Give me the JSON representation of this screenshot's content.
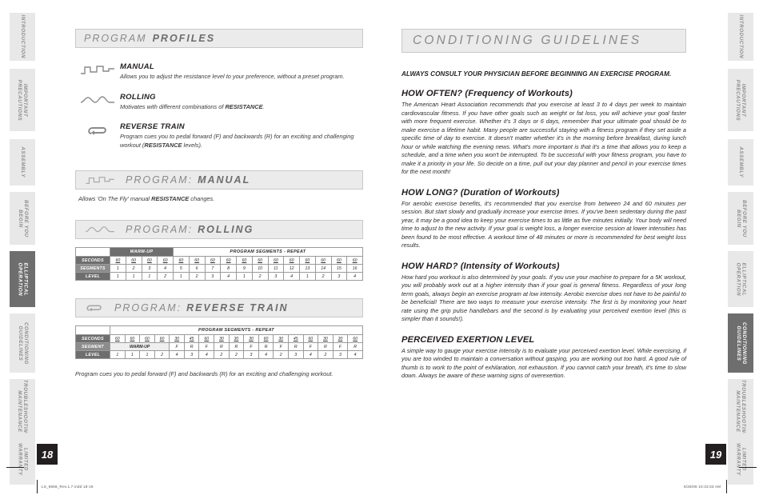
{
  "tabs_left": [
    {
      "label": "INTRODUCTION",
      "active": false
    },
    {
      "label": "IMPORTANT PRECAUTIONS",
      "active": false
    },
    {
      "label": "ASSEMBLY",
      "active": false
    },
    {
      "label": "BEFORE YOU BEGIN",
      "active": false
    },
    {
      "label": "ELLIPTICAL OPERATION",
      "active": true
    },
    {
      "label": "CONDITIONING GUIDELINES",
      "active": false
    },
    {
      "label": "TROUBLESHOOTING & MAINTENANCE",
      "active": false
    },
    {
      "label": "LIMITED WARRANTY",
      "active": false
    }
  ],
  "tabs_right": [
    {
      "label": "INTRODUCTION",
      "active": false
    },
    {
      "label": "IMPORTANT PRECAUTIONS",
      "active": false
    },
    {
      "label": "ASSEMBLY",
      "active": false
    },
    {
      "label": "BEFORE YOU BEGIN",
      "active": false
    },
    {
      "label": "ELLIPTICAL OPERATION",
      "active": false
    },
    {
      "label": "CONDITIONING GUIDELINES",
      "active": true
    },
    {
      "label": "TROUBLESHOOTING & MAINTENANCE",
      "active": false
    },
    {
      "label": "LIMITED WARRANTY",
      "active": false
    }
  ],
  "page_left": {
    "number": "18",
    "banner": {
      "word1": "PROGRAM",
      "word2": "PROFILES"
    },
    "profiles": [
      {
        "icon": "step-wave-icon",
        "title": "MANUAL",
        "desc_pre": "Allows you to adjust the resistance level to your preference, without a preset program.",
        "desc_bold": "",
        "desc_post": ""
      },
      {
        "icon": "rolling-wave-icon",
        "title": "ROLLING",
        "desc_pre": "Motivates with different combinations of ",
        "desc_bold": "RESISTANCE",
        "desc_post": "."
      },
      {
        "icon": "reverse-loop-icon",
        "title": "REVERSE TRAIN",
        "desc_pre": "Program cues you to pedal forward (F) and backwards (R) for an exciting and challenging workout (",
        "desc_bold": "RESISTANCE",
        "desc_post": " levels)."
      }
    ],
    "manual_section": {
      "banner_label": "PROGRAM:",
      "banner_name": "MANUAL",
      "note_pre": "Allows 'On The Fly' manual ",
      "note_bold": "RESISTANCE",
      "note_post": " changes."
    },
    "rolling_section": {
      "banner_label": "PROGRAM:",
      "banner_name": "ROLLING",
      "head_warmup": "WARM-UP",
      "head_segments": "PROGRAM SEGMENTS - REPEAT",
      "row_labels": [
        "SECONDS",
        "SEGMENTS",
        "LEVEL"
      ],
      "seconds": [
        "60",
        "60",
        "60",
        "60",
        "60",
        "60",
        "60",
        "60",
        "60",
        "60",
        "60",
        "60",
        "60",
        "60",
        "60",
        "60"
      ],
      "segments": [
        "1",
        "2",
        "3",
        "4",
        "5",
        "6",
        "7",
        "8",
        "9",
        "10",
        "11",
        "12",
        "13",
        "14",
        "15",
        "16"
      ],
      "level": [
        "1",
        "1",
        "1",
        "2",
        "1",
        "2",
        "3",
        "4",
        "1",
        "2",
        "3",
        "4",
        "1",
        "2",
        "3",
        "4"
      ],
      "warmup_cols": 4
    },
    "reverse_section": {
      "banner_label": "PROGRAM:",
      "banner_name": "REVERSE TRAIN",
      "head_segments": "PROGRAM SEGMENTS - REPEAT",
      "row_labels": [
        "SECONDS",
        "SEGMENT",
        "LEVEL"
      ],
      "warmup_label": "WARM-UP",
      "seconds": [
        "60",
        "60",
        "60",
        "60",
        "30",
        "45",
        "60",
        "30",
        "30",
        "30",
        "60",
        "30",
        "45",
        "60",
        "30",
        "30",
        "60"
      ],
      "segment": [
        "",
        "",
        "",
        "",
        "F",
        "R",
        "F",
        "R",
        "R",
        "F",
        "R",
        "F",
        "R",
        "F",
        "R",
        "F",
        "R"
      ],
      "level": [
        "1",
        "1",
        "1",
        "2",
        "4",
        "3",
        "4",
        "2",
        "2",
        "3",
        "4",
        "2",
        "3",
        "4",
        "2",
        "3",
        "4"
      ],
      "warmup_cols": 4,
      "footnote": "Program cues you to pedal forward (F) and backwards (R) for an exciting and challenging workout."
    }
  },
  "page_right": {
    "number": "19",
    "banner_title": "CONDITIONING GUIDELINES",
    "always_line": "ALWAYS CONSULT YOUR PHYSICIAN BEFORE BEGINNING AN EXERCISE PROGRAM.",
    "sections": [
      {
        "heading": "HOW OFTEN? (Frequency of Workouts)",
        "body": "The American Heart Association recommends that you exercise at least 3 to 4 days per week to maintain cardiovascular fitness. If you have other goals such as weight or fat loss, you will achieve your goal faster with more frequent exercise. Whether it's 3 days or 6 days, remember that your ultimate goal should be to make exercise a lifetime habit. Many people are successful staying with a fitness program if they set aside a specific time of day to exercise. It doesn't matter whether it's in the morning before breakfast, during lunch hour or while watching the evening news. What's more important is that it's a time that allows you to keep a schedule, and a time when you won't be interrupted. To be successful with your fitness program, you have to make it a priority in your life. So decide on a time, pull out your day planner and pencil in your exercise times for the next month!"
      },
      {
        "heading": "HOW LONG? (Duration of Workouts)",
        "body": "For aerobic exercise benefits, it's recommended that you exercise from between 24 and 60 minutes per session. But start slowly and gradually increase your exercise times. If you've been sedentary during the past year, it may be a good idea to keep your exercise times to as little as five minutes initially. Your body will need time to adjust to the new activity. If your goal is weight loss, a longer exercise session at lower intensities has been found to be most effective. A workout time of 48 minutes or more is recommended for best weight loss results."
      },
      {
        "heading": "HOW HARD? (Intensity of Workouts)",
        "body": "How hard you workout is also determined by your goals. If you use your machine to prepare for a 5K workout, you will probably work out at a higher intensity than if your goal is general fitness. Regardless of your long term goals, always begin an exercise program at low intensity. Aerobic exercise does not have to be painful to be beneficial! There are two ways to measure your exercise intensity. The first is by monitoring your heart rate using the grip pulse handlebars and the second is by evaluating your perceived exertion level (this is simpler than it sounds!)."
      },
      {
        "heading": "PERCEIVED EXERTION LEVEL",
        "body": "A simple way to gauge your exercise intensity is to evaluate your perceived exertion level. While exercising, if you are too winded to maintain a conversation without gasping, you are working out too hard. A good rule of thumb is to work to the point of exhilaration, not exhaustion. If you cannot catch your breath, it's time to slow down. Always be aware of these warning signs of overexertion."
      }
    ]
  },
  "print_footer": {
    "file": "LS_6656_Rev.1.7.indd   18-19",
    "stamp": "6/26/06   10:43:33 AM"
  },
  "colors": {
    "tab_inactive_bg": "#e8e8e8",
    "tab_active_bg": "#6e6e6e",
    "banner_bg": "#ebebeb",
    "table_header": "#6e6e6e",
    "ink": "#231f20"
  }
}
